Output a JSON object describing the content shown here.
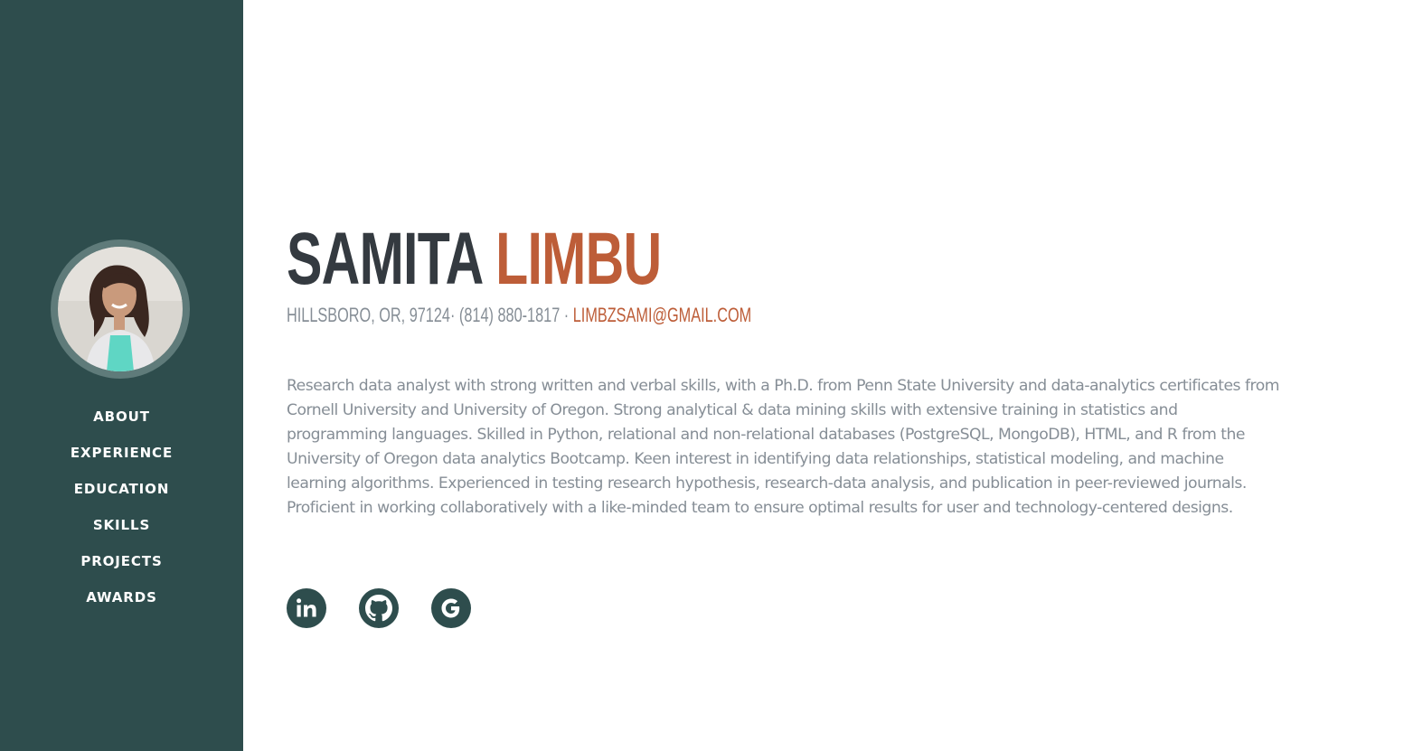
{
  "sidebar": {
    "nav": [
      {
        "label": "ABOUT"
      },
      {
        "label": "EXPERIENCE"
      },
      {
        "label": "EDUCATION"
      },
      {
        "label": "SKILLS"
      },
      {
        "label": "PROJECTS"
      },
      {
        "label": "AWARDS"
      }
    ]
  },
  "profile": {
    "first_name": "SAMITA",
    "last_name": "LIMBU",
    "location": "HILLSBORO, OR, 97124",
    "phone": "(814) 880-1817",
    "email": "LIMBZSAMI@GMAIL.COM",
    "summary": "Research data analyst with strong written and verbal skills, with a Ph.D. from Penn State University and data-analytics certificates from Cornell University and University of Oregon. Strong analytical & data mining skills with extensive training in statistics and programming languages. Skilled in Python, relational and non-relational databases (PostgreSQL, MongoDB), HTML, and R from the University of Oregon data analytics Bootcamp. Keen interest in identifying data relationships, statistical modeling, and machine learning algorithms. Experienced in testing research hypothesis, research-data analysis, and publication in peer-reviewed journals. Proficient in working collaboratively with a like-minded team to ensure optimal results for user and technology-centered designs."
  },
  "social": [
    {
      "icon": "linkedin-icon"
    },
    {
      "icon": "github-icon"
    },
    {
      "icon": "google-icon"
    }
  ],
  "colors": {
    "sidebar_bg": "#2e4d4d",
    "accent": "#bd5d38",
    "heading": "#343a40",
    "muted": "#868e96"
  }
}
